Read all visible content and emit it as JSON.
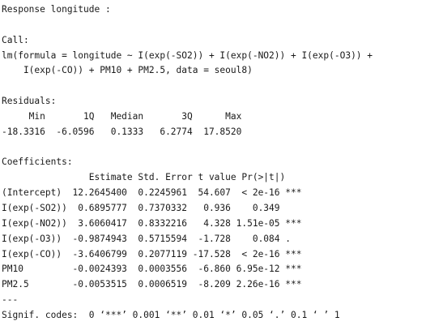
{
  "output": {
    "lines": [
      "Response longitude :",
      "",
      "Call:",
      "lm(formula = longitude ~ I(exp(-SO2)) + I(exp(-NO2)) + I(exp(-O3)) +",
      "    I(exp(-CO)) + PM10 + PM2.5, data = seoul8)",
      "",
      "Residuals:",
      "     Min       1Q   Median       3Q      Max ",
      "-18.3316  -6.0596   0.1333   6.2774  17.8520 ",
      "",
      "Coefficients:",
      "                Estimate Std. Error t value Pr(>|t|)    ",
      "(Intercept)  12.2645400  0.2245961  54.607  < 2e-16 ***",
      "I(exp(-SO2))  0.6895777  0.7370332   0.936    0.349    ",
      "I(exp(-NO2))  3.6060417  0.8332216   4.328 1.51e-05 ***",
      "I(exp(-O3))  -0.9874943  0.5715594  -1.728    0.084 .  ",
      "I(exp(-CO))  -3.6406799  0.2077119 -17.528  < 2e-16 ***",
      "PM10         -0.0024393  0.0003556  -6.860 6.95e-12 ***",
      "PM2.5        -0.0053515  0.0006519  -8.209 2.26e-16 ***",
      "---",
      "Signif. codes:  0 ‘***’ 0.001 ‘**’ 0.01 ‘*’ 0.05 ‘.’ 0.1 ‘ ’ 1"
    ]
  }
}
